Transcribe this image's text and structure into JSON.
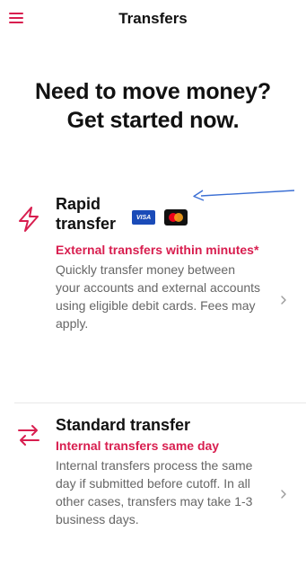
{
  "header": {
    "title": "Transfers",
    "menu_icon": "hamburger-menu-icon",
    "accent_color": "#d81e4f"
  },
  "hero": {
    "line1": "Need to move money?",
    "line2": "Get started now."
  },
  "options": [
    {
      "icon": "lightning-bolt-icon",
      "title": "Rapid transfer",
      "subtitle": "External transfers within minutes*",
      "description": "Quickly transfer money between your accounts and external accounts using eligible debit cards. Fees may apply.",
      "card_logos": [
        "VISA",
        "mastercard"
      ]
    },
    {
      "icon": "swap-arrows-icon",
      "title": "Standard transfer",
      "subtitle": "Internal transfers same day",
      "description": "Internal transfers process the same day if submitted before cutoff. In all other cases, transfers may take 1-3 business days."
    }
  ],
  "colors": {
    "accent": "#d81e4f",
    "annotation_arrow": "#3b6fd4",
    "description_text": "#666666"
  }
}
